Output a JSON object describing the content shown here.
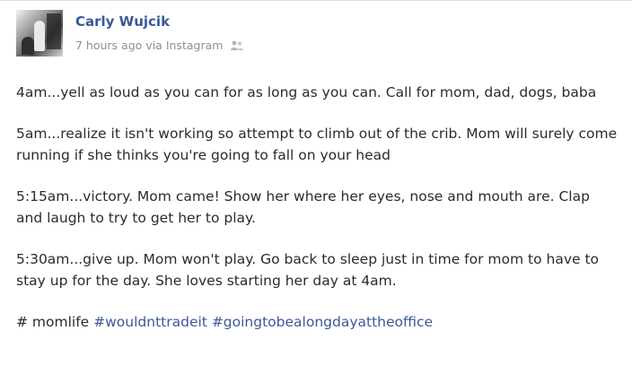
{
  "post": {
    "author": "Carly Wujcik",
    "time": "7 hours ago",
    "via_prefix": "via",
    "via_app": "Instagram",
    "paragraphs": [
      "4am...yell as loud as you can for as long as you can. Call for mom, dad, dogs, baba",
      "5am...realize it isn't working so attempt to climb out of the crib. Mom will surely come running if she thinks you're going to fall on your head",
      "5:15am...victory. Mom came! Show her where her eyes, nose and mouth are. Clap and laugh to try to get her to play.",
      "5:30am...give up. Mom won't play. Go back to sleep just in time for mom to have to stay up for the day. She loves starting her day at 4am."
    ],
    "hashtags": {
      "plain": "# momlife",
      "tag1": "#wouldnttradeit",
      "tag2": "#goingtobealongdayattheoffice"
    }
  },
  "icons": {
    "privacy": "friends-audience-icon"
  },
  "colors": {
    "link": "#3b5998",
    "meta": "#8f8f8f",
    "text": "#2b2b2b"
  }
}
